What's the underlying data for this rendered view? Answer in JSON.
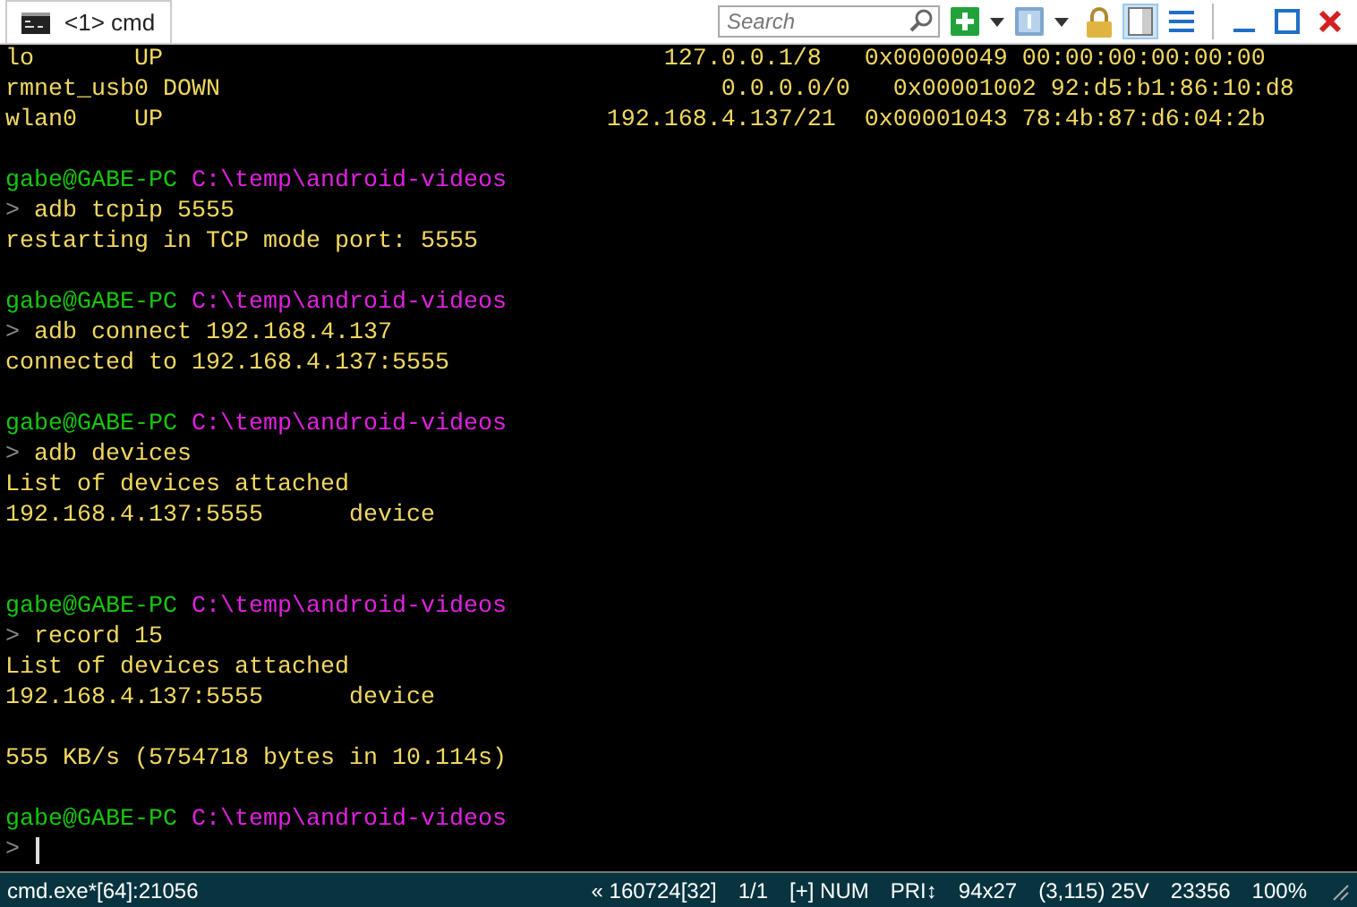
{
  "tab": {
    "label": "<1> cmd",
    "selected": true
  },
  "search": {
    "placeholder": "Search"
  },
  "toolbar": [
    {
      "kind": "new-console"
    },
    {
      "kind": "caret"
    },
    {
      "kind": "console-number"
    },
    {
      "kind": "caret"
    },
    {
      "kind": "lock"
    },
    {
      "kind": "split",
      "selected": true
    },
    {
      "kind": "menu"
    },
    {
      "kind": "separator"
    },
    {
      "kind": "minimize"
    },
    {
      "kind": "maximize"
    },
    {
      "kind": "close"
    }
  ],
  "terminal": [
    {
      "kind": "output",
      "text": "lo       UP                                   127.0.0.1/8   0x00000049 00:00:00:00:00:00"
    },
    {
      "kind": "output",
      "text": "rmnet_usb0 DOWN                                   0.0.0.0/0   0x00001002 92:d5:b1:86:10:d8"
    },
    {
      "kind": "output",
      "text": "wlan0    UP                               192.168.4.137/21  0x00001043 78:4b:87:d6:04:2b"
    },
    {
      "kind": "blank"
    },
    {
      "kind": "prompt",
      "user": "gabe@GABE-PC",
      "path": "C:\\temp\\android-videos"
    },
    {
      "kind": "command",
      "marker": ">",
      "text": "adb tcpip 5555"
    },
    {
      "kind": "output",
      "text": "restarting in TCP mode port: 5555"
    },
    {
      "kind": "blank"
    },
    {
      "kind": "prompt",
      "user": "gabe@GABE-PC",
      "path": "C:\\temp\\android-videos"
    },
    {
      "kind": "command",
      "marker": ">",
      "text": "adb connect 192.168.4.137"
    },
    {
      "kind": "output",
      "text": "connected to 192.168.4.137:5555"
    },
    {
      "kind": "blank"
    },
    {
      "kind": "prompt",
      "user": "gabe@GABE-PC",
      "path": "C:\\temp\\android-videos"
    },
    {
      "kind": "command",
      "marker": ">",
      "text": "adb devices"
    },
    {
      "kind": "output",
      "text": "List of devices attached"
    },
    {
      "kind": "output",
      "text": "192.168.4.137:5555      device"
    },
    {
      "kind": "blank"
    },
    {
      "kind": "blank"
    },
    {
      "kind": "prompt",
      "user": "gabe@GABE-PC",
      "path": "C:\\temp\\android-videos"
    },
    {
      "kind": "command",
      "marker": ">",
      "text": "record 15"
    },
    {
      "kind": "output",
      "text": "List of devices attached"
    },
    {
      "kind": "output",
      "text": "192.168.4.137:5555      device"
    },
    {
      "kind": "blank"
    },
    {
      "kind": "output",
      "text": "555 KB/s (5754718 bytes in 10.114s)"
    },
    {
      "kind": "blank"
    },
    {
      "kind": "prompt",
      "user": "gabe@GABE-PC",
      "path": "C:\\temp\\android-videos"
    },
    {
      "kind": "cursor",
      "marker": ">"
    }
  ],
  "status_bar": {
    "process": "cmd.exe*[64]:21056",
    "items": [
      "« 160724[32]",
      "1/1",
      "[+] NUM",
      "PRI↕",
      "94x27",
      "(3,115) 25V",
      "23356",
      "100%"
    ]
  }
}
